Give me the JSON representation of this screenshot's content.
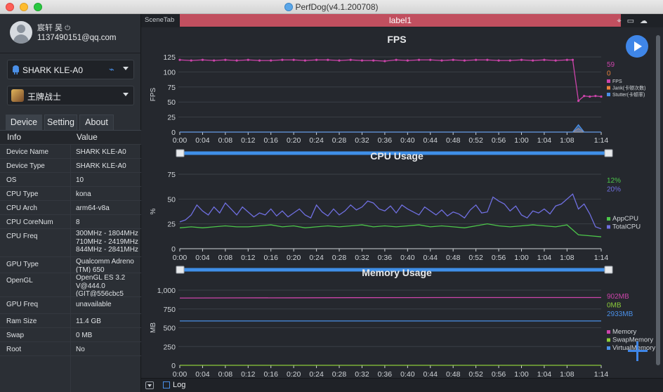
{
  "window": {
    "title": "PerfDog(v4.1.200708)"
  },
  "user": {
    "name": "宸轩 吴",
    "email": "1137490151@qq.com"
  },
  "device_select": {
    "value": "SHARK KLE-A0"
  },
  "app_select": {
    "value": "王牌战士"
  },
  "tabs": [
    {
      "label": "Device"
    },
    {
      "label": "Setting"
    },
    {
      "label": "About"
    }
  ],
  "info": {
    "header": {
      "key": "Info",
      "value": "Value"
    },
    "rows": [
      {
        "key": "Device Name",
        "value": "SHARK KLE-A0"
      },
      {
        "key": "Device Type",
        "value": "SHARK KLE-A0"
      },
      {
        "key": "OS",
        "value": "10"
      },
      {
        "key": "CPU Type",
        "value": "kona"
      },
      {
        "key": "CPU Arch",
        "value": "arm64-v8a"
      },
      {
        "key": "CPU CoreNum",
        "value": "8"
      },
      {
        "key": "CPU Freq",
        "value": "300MHz - 1804MHz\n710MHz - 2419MHz\n844MHz - 2841MHz"
      },
      {
        "key": "GPU Type",
        "value": "Qualcomm Adreno\n(TM) 650"
      },
      {
        "key": "OpenGL",
        "value": "OpenGL ES 3.2\nV@444.0\n(GIT@556cbc5"
      },
      {
        "key": "GPU Freq",
        "value": "unavailable"
      },
      {
        "key": "Ram Size",
        "value": "11.4 GB"
      },
      {
        "key": "Swap",
        "value": "0 MB"
      },
      {
        "key": "Root",
        "value": "No"
      }
    ]
  },
  "scene": {
    "tab_label": "SceneTab",
    "label": "label1"
  },
  "bottom": {
    "log_label": "Log"
  },
  "colors": {
    "fps": "#cc44aa",
    "jank": "#e8823c",
    "stutter": "#4a8fe7",
    "app_cpu": "#4cc64a",
    "total_cpu": "#6f6fe0",
    "memory": "#cc44aa",
    "swap": "#8ccc3a",
    "virtual": "#4a8fe7"
  },
  "chart_data": [
    {
      "type": "line",
      "title": "FPS",
      "ylabel": "FPS",
      "ylim": [
        0,
        125
      ],
      "yticks": [
        0,
        25,
        50,
        75,
        100,
        125
      ],
      "x_ticks": [
        "0:00",
        "0:04",
        "0:08",
        "0:12",
        "0:16",
        "0:20",
        "0:24",
        "0:28",
        "0:32",
        "0:36",
        "0:40",
        "0:44",
        "0:48",
        "0:52",
        "0:56",
        "1:00",
        "1:04",
        "1:08",
        "1:14"
      ],
      "x_seconds": [
        0,
        4,
        8,
        12,
        16,
        20,
        24,
        28,
        32,
        36,
        40,
        44,
        48,
        52,
        56,
        60,
        64,
        68,
        74
      ],
      "legend": [
        {
          "name": "FPS",
          "color": "#cc44aa",
          "current": "59",
          "current_color": "#cc44aa"
        },
        {
          "name": "Jank(卡顿次数)",
          "color": "#e8823c",
          "current": "0",
          "current_color": "#e8823c"
        },
        {
          "name": "Stutter(卡顿率)",
          "color": "#4a8fe7",
          "current": "",
          "current_color": ""
        }
      ],
      "series": [
        {
          "name": "FPS",
          "color": "#cc44aa",
          "x": [
            0,
            2,
            4,
            6,
            8,
            10,
            12,
            14,
            16,
            18,
            20,
            22,
            24,
            26,
            28,
            30,
            32,
            34,
            36,
            38,
            40,
            42,
            44,
            46,
            48,
            50,
            52,
            54,
            56,
            58,
            60,
            62,
            64,
            66,
            68,
            69,
            70,
            71,
            72,
            73,
            74
          ],
          "values": [
            120,
            119,
            120,
            119,
            120,
            119,
            120,
            119,
            119,
            120,
            120,
            119,
            120,
            120,
            119,
            120,
            119,
            119,
            118,
            120,
            119,
            120,
            120,
            119,
            120,
            119,
            120,
            120,
            119,
            119,
            120,
            119,
            120,
            119,
            120,
            120,
            52,
            60,
            59,
            60,
            59
          ]
        },
        {
          "name": "Jank(卡顿次数)",
          "color": "#e8823c",
          "x": [
            0,
            68,
            69,
            70,
            71,
            72,
            74
          ],
          "values": [
            0,
            0,
            0,
            6,
            0,
            0,
            0
          ]
        },
        {
          "name": "Stutter(卡顿率)",
          "color": "#4a8fe7",
          "x": [
            0,
            68,
            69,
            70,
            71,
            72,
            74
          ],
          "values": [
            0,
            0,
            0,
            12,
            0,
            0,
            0
          ]
        }
      ]
    },
    {
      "type": "line",
      "title": "CPU Usage",
      "ylabel": "%",
      "ylim": [
        0,
        75
      ],
      "yticks": [
        0,
        25,
        50,
        75
      ],
      "x_ticks": [
        "0:00",
        "0:04",
        "0:08",
        "0:12",
        "0:16",
        "0:20",
        "0:24",
        "0:28",
        "0:32",
        "0:36",
        "0:40",
        "0:44",
        "0:48",
        "0:52",
        "0:56",
        "1:00",
        "1:04",
        "1:08",
        "1:14"
      ],
      "x_seconds": [
        0,
        4,
        8,
        12,
        16,
        20,
        24,
        28,
        32,
        36,
        40,
        44,
        48,
        52,
        56,
        60,
        64,
        68,
        74
      ],
      "legend": [
        {
          "name": "AppCPU",
          "color": "#4cc64a",
          "current": "12%",
          "current_color": "#4cc64a"
        },
        {
          "name": "TotalCPU",
          "color": "#6f6fe0",
          "current": "20%",
          "current_color": "#6f6fe0"
        }
      ],
      "series": [
        {
          "name": "AppCPU",
          "color": "#4cc64a",
          "x": [
            0,
            2,
            4,
            6,
            8,
            10,
            12,
            14,
            16,
            18,
            20,
            22,
            24,
            26,
            28,
            30,
            32,
            34,
            36,
            38,
            40,
            42,
            44,
            46,
            48,
            50,
            52,
            54,
            56,
            58,
            60,
            62,
            64,
            66,
            68,
            70,
            72,
            74
          ],
          "values": [
            21,
            22,
            21,
            22,
            23,
            22,
            22,
            23,
            24,
            22,
            23,
            21,
            22,
            23,
            22,
            23,
            24,
            22,
            23,
            22,
            23,
            24,
            22,
            23,
            22,
            21,
            23,
            25,
            23,
            22,
            23,
            24,
            23,
            22,
            24,
            14,
            13,
            12
          ]
        },
        {
          "name": "TotalCPU",
          "color": "#6f6fe0",
          "x": [
            0,
            1,
            2,
            3,
            4,
            5,
            6,
            7,
            8,
            9,
            10,
            11,
            12,
            13,
            14,
            15,
            16,
            17,
            18,
            19,
            20,
            21,
            22,
            23,
            24,
            25,
            26,
            27,
            28,
            29,
            30,
            31,
            32,
            33,
            34,
            35,
            36,
            37,
            38,
            39,
            40,
            41,
            42,
            43,
            44,
            45,
            46,
            47,
            48,
            49,
            50,
            51,
            52,
            53,
            54,
            55,
            56,
            57,
            58,
            59,
            60,
            61,
            62,
            63,
            64,
            65,
            66,
            67,
            68,
            69,
            70,
            71,
            72,
            73,
            74
          ],
          "values": [
            27,
            29,
            34,
            44,
            38,
            34,
            42,
            36,
            46,
            40,
            34,
            42,
            37,
            32,
            36,
            34,
            40,
            33,
            38,
            32,
            36,
            40,
            34,
            31,
            44,
            37,
            33,
            40,
            34,
            38,
            44,
            39,
            42,
            48,
            46,
            40,
            38,
            43,
            36,
            44,
            40,
            37,
            34,
            42,
            38,
            34,
            39,
            33,
            37,
            35,
            31,
            39,
            44,
            36,
            37,
            52,
            48,
            45,
            38,
            43,
            34,
            31,
            38,
            36,
            40,
            35,
            43,
            45,
            50,
            55,
            40,
            45,
            35,
            22,
            20
          ]
        }
      ]
    },
    {
      "type": "line",
      "title": "Memory Usage",
      "ylabel": "MB",
      "ylim": [
        0,
        1000
      ],
      "ytick_labels": [
        "0",
        "250",
        "500",
        "750",
        "1,000"
      ],
      "yticks": [
        0,
        250,
        500,
        750,
        1000
      ],
      "x_ticks": [
        "0:00",
        "0:04",
        "0:08",
        "0:12",
        "0:16",
        "0:20",
        "0:24",
        "0:28",
        "0:32",
        "0:36",
        "0:40",
        "0:44",
        "0:48",
        "0:52",
        "0:56",
        "1:00",
        "1:04",
        "1:08",
        "1:14"
      ],
      "x_seconds": [
        0,
        4,
        8,
        12,
        16,
        20,
        24,
        28,
        32,
        36,
        40,
        44,
        48,
        52,
        56,
        60,
        64,
        68,
        74
      ],
      "legend": [
        {
          "name": "Memory",
          "color": "#cc44aa",
          "current": "902MB",
          "current_color": "#cc44aa"
        },
        {
          "name": "SwapMemory",
          "color": "#8ccc3a",
          "current": "0MB",
          "current_color": "#8ccc3a"
        },
        {
          "name": "VirtualMemory",
          "color": "#4a8fe7",
          "current": "2933MB",
          "current_color": "#4a8fe7"
        }
      ],
      "series": [
        {
          "name": "Memory",
          "color": "#cc44aa",
          "x": [
            0,
            10,
            20,
            30,
            40,
            50,
            60,
            70,
            74
          ],
          "values": [
            895,
            897,
            898,
            900,
            901,
            902,
            902,
            902,
            902
          ]
        },
        {
          "name": "SwapMemory",
          "color": "#8ccc3a",
          "x": [
            0,
            74
          ],
          "values": [
            0,
            0
          ]
        },
        {
          "name": "VirtualMemory",
          "color": "#4a8fe7",
          "x": [
            0,
            74
          ],
          "values": [
            590,
            590
          ]
        }
      ]
    }
  ]
}
